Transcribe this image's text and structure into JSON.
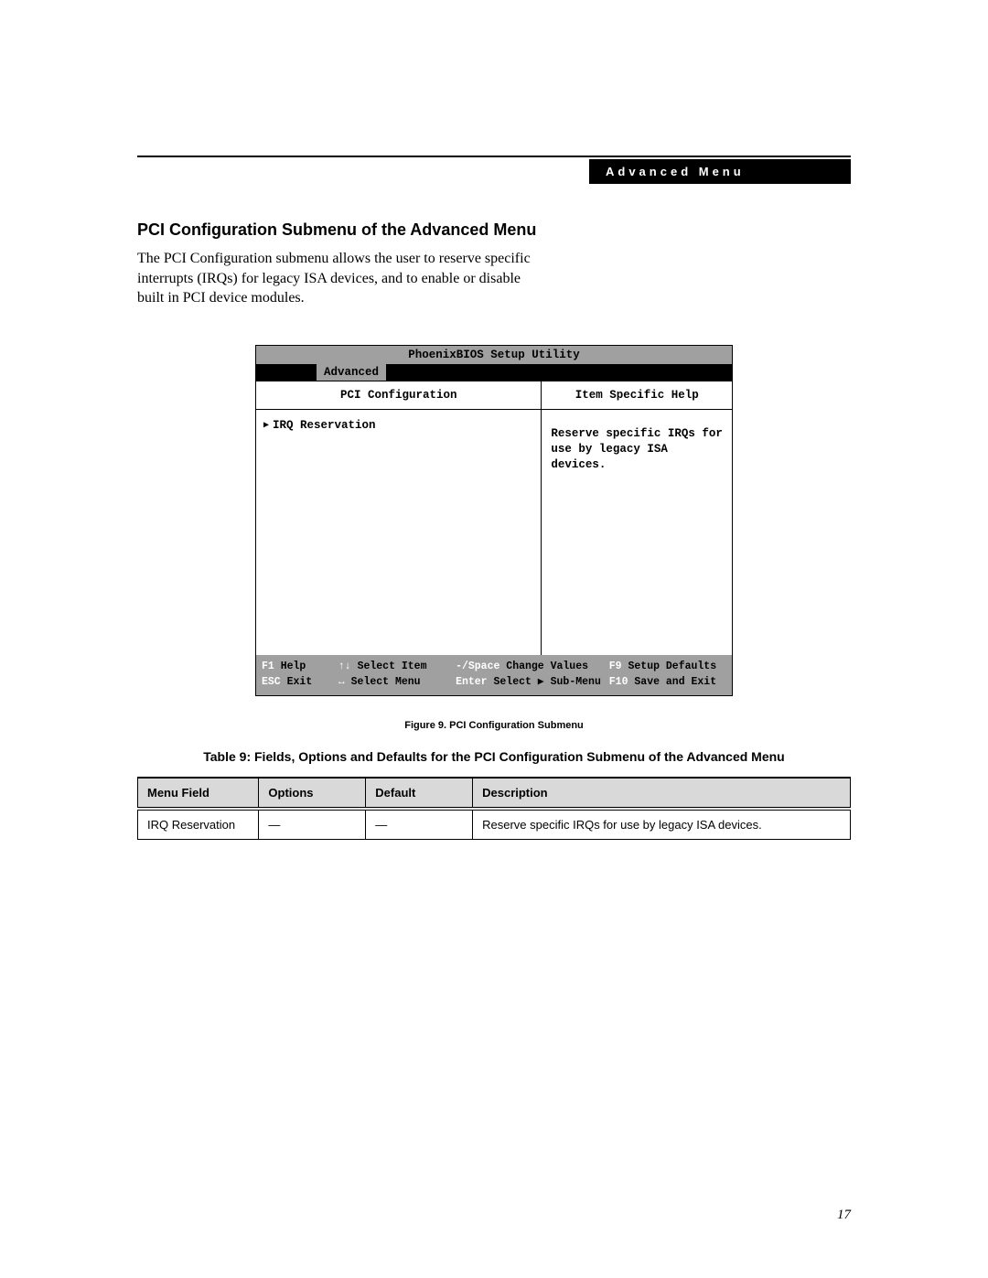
{
  "header": {
    "label": "Advanced Menu"
  },
  "section": {
    "title": "PCI Configuration Submenu of the Advanced Menu",
    "body": "The PCI Configuration submenu allows the user to reserve specific interrupts (IRQs) for legacy ISA devices, and to enable or disable built in PCI device modules."
  },
  "bios": {
    "title": "PhoenixBIOS Setup Utility",
    "active_tab": "Advanced",
    "left_panel_title": "PCI Configuration",
    "right_panel_title": "Item Specific Help",
    "submenu_item": "IRQ Reservation",
    "help_text": "Reserve specific IRQs for use by legacy ISA devices.",
    "footer": {
      "row1": {
        "k1": "F1",
        "a1": "Help",
        "k2": "↑↓",
        "a2": "Select Item",
        "k3": "-/Space",
        "a3": "Change Values",
        "k4": "F9",
        "a4": "Setup Defaults"
      },
      "row2": {
        "k1": "ESC",
        "a1": "Exit",
        "k2": "↔",
        "a2": "Select Menu",
        "k3": "Enter",
        "a3": "Select ▶ Sub-Menu",
        "k4": "F10",
        "a4": "Save and Exit"
      }
    }
  },
  "figure_caption": "Figure 9.  PCI Configuration Submenu",
  "table": {
    "title": "Table 9: Fields, Options and Defaults for  the PCI Configuration Submenu of the Advanced Menu",
    "headers": {
      "c1": "Menu Field",
      "c2": "Options",
      "c3": "Default",
      "c4": "Description"
    },
    "rows": [
      {
        "c1": "IRQ Reservation",
        "c2": "—",
        "c3": "—",
        "c4": "Reserve specific IRQs for use by legacy ISA devices."
      }
    ]
  },
  "page_number": "17"
}
